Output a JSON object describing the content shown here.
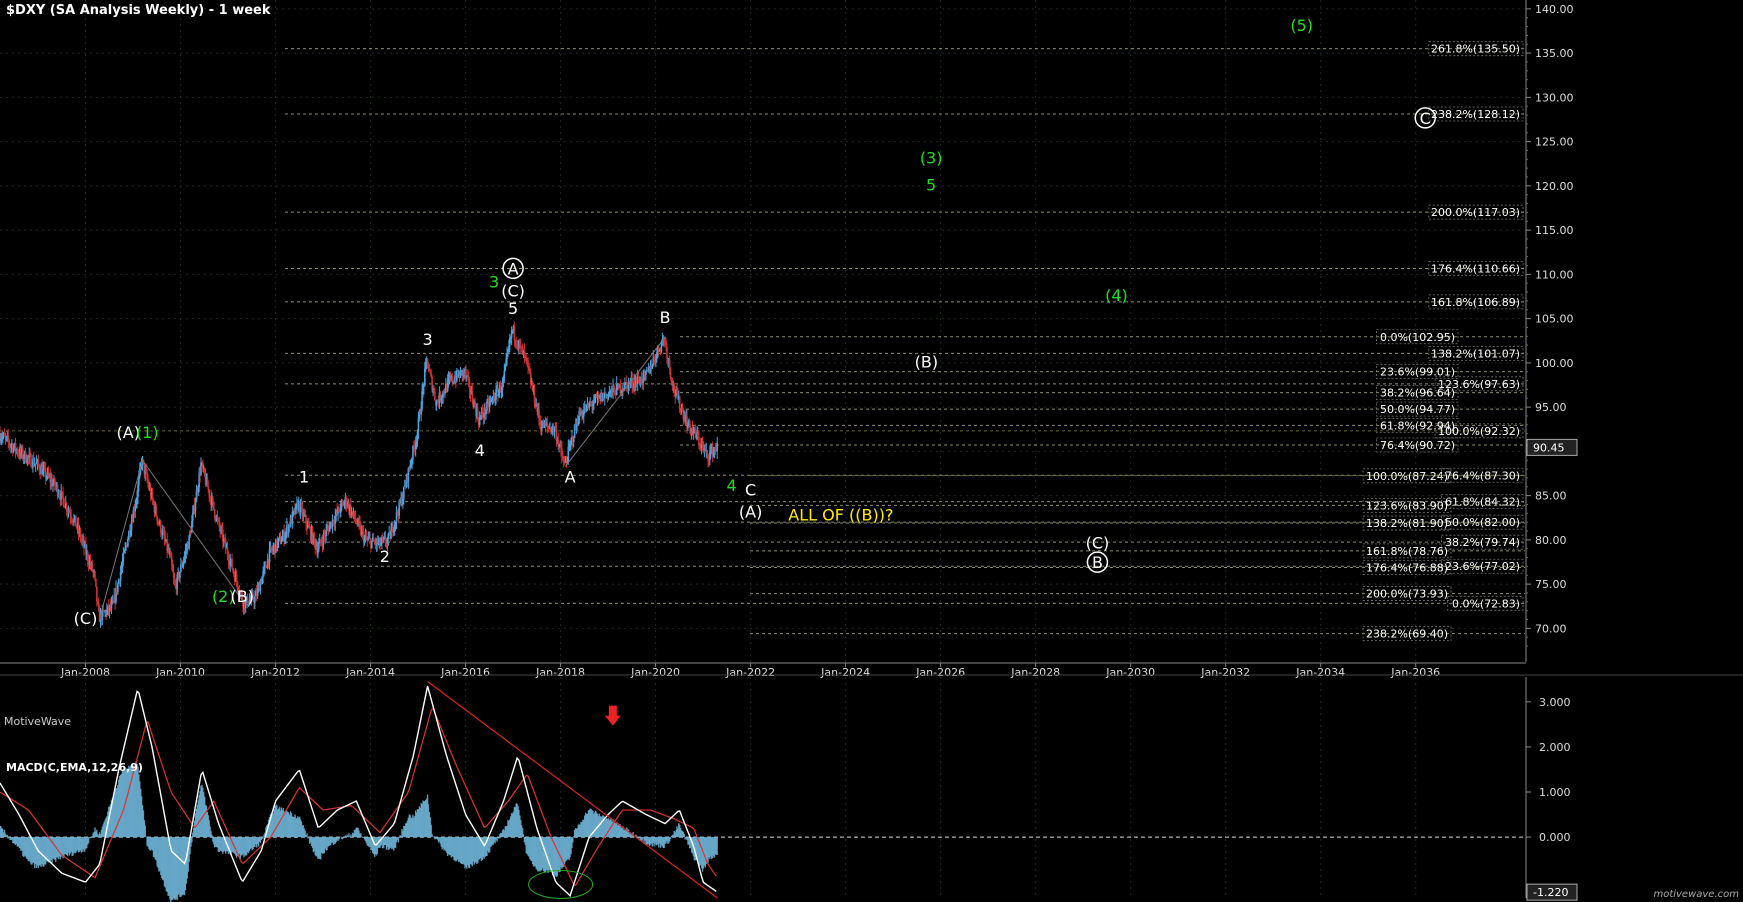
{
  "title": "$DXY (SA Analysis Weekly) - 1 week",
  "brand": "MotiveWave",
  "footer": "motivewave.com",
  "colors": {
    "background": "#000000",
    "white_label": "#ffffff",
    "green_label": "#22dd22",
    "yellow_label": "#ffee00",
    "fib_line": "#c8c8a0",
    "candle_up": "#4aa3df",
    "candle_down": "#cc3333",
    "macd_line": "#ffffff",
    "signal_line": "#dd3333",
    "histogram": "#6fb4d8",
    "trendline": "#dd2222"
  },
  "chart_data": [
    {
      "type": "candlestick",
      "title": "$DXY (SA Analysis Weekly) - 1 week",
      "x_range": [
        2006.2,
        2038.3
      ],
      "y_range": [
        66.2,
        141.0
      ],
      "y_scale": "linear",
      "grid": true,
      "x_ticks": [
        "Jan-2008",
        "Jan-2010",
        "Jan-2012",
        "Jan-2014",
        "Jan-2016",
        "Jan-2018",
        "Jan-2020",
        "Jan-2022",
        "Jan-2024",
        "Jan-2026",
        "Jan-2028",
        "Jan-2030",
        "Jan-2032",
        "Jan-2034",
        "Jan-2036"
      ],
      "y_ticks": [
        "70.00",
        "75.00",
        "80.00",
        "85.00",
        "90.00",
        "95.00",
        "100.00",
        "105.00",
        "110.00",
        "115.00",
        "120.00",
        "125.00",
        "130.00",
        "135.00",
        "140.00"
      ],
      "last_price_label": "90.45",
      "last_price": 90.45,
      "price_path": [
        [
          2006.2,
          92.0
        ],
        [
          2006.6,
          90.0
        ],
        [
          2007.0,
          88.5
        ],
        [
          2007.4,
          86.0
        ],
        [
          2007.8,
          82.0
        ],
        [
          2008.2,
          76.0
        ],
        [
          2008.3,
          71.2
        ],
        [
          2008.6,
          72.5
        ],
        [
          2008.9,
          80.0
        ],
        [
          2009.1,
          85.0
        ],
        [
          2009.2,
          89.0
        ],
        [
          2009.5,
          83.0
        ],
        [
          2009.8,
          78.0
        ],
        [
          2009.9,
          74.5
        ],
        [
          2010.2,
          80.0
        ],
        [
          2010.45,
          88.5
        ],
        [
          2010.8,
          82.0
        ],
        [
          2011.1,
          77.0
        ],
        [
          2011.35,
          72.8
        ],
        [
          2011.6,
          73.5
        ],
        [
          2011.9,
          78.5
        ],
        [
          2012.2,
          80.5
        ],
        [
          2012.5,
          84.0
        ],
        [
          2012.9,
          79.0
        ],
        [
          2013.2,
          82.0
        ],
        [
          2013.5,
          84.5
        ],
        [
          2013.9,
          80.0
        ],
        [
          2014.2,
          79.5
        ],
        [
          2014.4,
          80.0
        ],
        [
          2014.7,
          85.0
        ],
        [
          2015.0,
          92.0
        ],
        [
          2015.2,
          100.3
        ],
        [
          2015.4,
          95.5
        ],
        [
          2015.7,
          98.0
        ],
        [
          2016.0,
          99.0
        ],
        [
          2016.3,
          93.5
        ],
        [
          2016.6,
          96.0
        ],
        [
          2016.8,
          97.5
        ],
        [
          2017.0,
          103.8
        ],
        [
          2017.3,
          100.0
        ],
        [
          2017.6,
          93.0
        ],
        [
          2017.9,
          92.5
        ],
        [
          2018.1,
          88.3
        ],
        [
          2018.4,
          94.0
        ],
        [
          2018.7,
          95.5
        ],
        [
          2019.0,
          96.5
        ],
        [
          2019.4,
          97.5
        ],
        [
          2019.8,
          98.3
        ],
        [
          2020.2,
          102.9
        ],
        [
          2020.4,
          97.0
        ],
        [
          2020.7,
          93.0
        ],
        [
          2020.9,
          91.5
        ],
        [
          2021.1,
          89.5
        ],
        [
          2021.3,
          90.45
        ]
      ],
      "fibonacci_levels": [
        {
          "label": "261.8%(135.50)",
          "value": 135.5
        },
        {
          "label": "238.2%(128.12)",
          "value": 128.12
        },
        {
          "label": "200.0%(117.03)",
          "value": 117.03
        },
        {
          "label": "176.4%(110.66)",
          "value": 110.66
        },
        {
          "label": "161.8%(106.89)",
          "value": 106.89
        },
        {
          "label": "0.0%(102.95)",
          "value": 102.95
        },
        {
          "label": "138.2%(101.07)",
          "value": 101.07
        },
        {
          "label": "23.6%(99.01)",
          "value": 99.01
        },
        {
          "label": "123.6%(97.63)",
          "value": 97.63
        },
        {
          "label": "38.2%(96.64)",
          "value": 96.64
        },
        {
          "label": "50.0%(94.77)",
          "value": 94.77
        },
        {
          "label": "61.8%(92.94)",
          "value": 92.94
        },
        {
          "label": "100.0%(92.32)",
          "value": 92.32
        },
        {
          "label": "76.4%(90.72)",
          "value": 90.72
        },
        {
          "label": "100.0%(87.24)",
          "value": 87.24
        },
        {
          "label": "76.4%(87.30)",
          "value": 87.3
        },
        {
          "label": "61.8%(84.32)",
          "value": 84.32
        },
        {
          "label": "123.6%(83.90)",
          "value": 83.9
        },
        {
          "label": "50.0%(82.00)",
          "value": 82.0
        },
        {
          "label": "138.2%(81.90)",
          "value": 81.9
        },
        {
          "label": "38.2%(79.74)",
          "value": 79.74
        },
        {
          "label": "161.8%(78.76)",
          "value": 78.76
        },
        {
          "label": "23.6%(77.02)",
          "value": 77.02
        },
        {
          "label": "176.4%(76.88)",
          "value": 76.88
        },
        {
          "label": "200.0%(73.93)",
          "value": 73.93
        },
        {
          "label": "0.0%(72.83)",
          "value": 72.83
        },
        {
          "label": "238.2%(69.40)",
          "value": 69.4
        }
      ],
      "wave_labels": [
        {
          "text": "(C)",
          "x": 2008.0,
          "y": 70.5,
          "color": "white"
        },
        {
          "text": "(A)",
          "x": 2008.9,
          "y": 91.5,
          "color": "white"
        },
        {
          "text": "(1)",
          "x": 2009.3,
          "y": 91.5,
          "color": "green"
        },
        {
          "text": "(2)",
          "x": 2010.9,
          "y": 73.0,
          "color": "green"
        },
        {
          "text": "(B)",
          "x": 2011.3,
          "y": 73.0,
          "color": "white"
        },
        {
          "text": "1",
          "x": 2012.6,
          "y": 86.5,
          "color": "white"
        },
        {
          "text": "2",
          "x": 2014.3,
          "y": 77.5,
          "color": "white"
        },
        {
          "text": "3",
          "x": 2015.2,
          "y": 102.0,
          "color": "white"
        },
        {
          "text": "4",
          "x": 2016.3,
          "y": 89.5,
          "color": "white"
        },
        {
          "text": "3",
          "x": 2016.6,
          "y": 108.5,
          "color": "green"
        },
        {
          "text": "5",
          "x": 2017.0,
          "y": 105.5,
          "color": "white"
        },
        {
          "text": "(C)",
          "x": 2017.0,
          "y": 107.5,
          "color": "white"
        },
        {
          "text": "A",
          "x": 2017.0,
          "y": 110.0,
          "color": "white",
          "circled": true
        },
        {
          "text": "A",
          "x": 2018.2,
          "y": 86.5,
          "color": "white"
        },
        {
          "text": "B",
          "x": 2020.2,
          "y": 104.5,
          "color": "white"
        },
        {
          "text": "4",
          "x": 2021.6,
          "y": 85.5,
          "color": "green"
        },
        {
          "text": "C",
          "x": 2022.0,
          "y": 85.0,
          "color": "white"
        },
        {
          "text": "(A)",
          "x": 2022.0,
          "y": 82.5,
          "color": "white"
        },
        {
          "text": "ALL OF ((B))?",
          "x": 2023.9,
          "y": 82.2,
          "color": "yellow"
        },
        {
          "text": "(3)",
          "x": 2025.8,
          "y": 122.5,
          "color": "green"
        },
        {
          "text": "5",
          "x": 2025.8,
          "y": 119.5,
          "color": "green"
        },
        {
          "text": "(B)",
          "x": 2025.7,
          "y": 99.5,
          "color": "white"
        },
        {
          "text": "(4)",
          "x": 2029.7,
          "y": 107.0,
          "color": "green"
        },
        {
          "text": "(5)",
          "x": 2033.6,
          "y": 137.5,
          "color": "green"
        },
        {
          "text": "(C)",
          "x": 2029.3,
          "y": 79.0,
          "color": "white"
        },
        {
          "text": "B",
          "x": 2029.3,
          "y": 76.8,
          "color": "white",
          "circled": true
        },
        {
          "text": "C",
          "x": 2036.2,
          "y": 127.0,
          "color": "white",
          "circled": true
        }
      ]
    },
    {
      "type": "line",
      "title": "MACD(C,EMA,12,26,9)",
      "y_range": [
        -1.35,
        3.55
      ],
      "y_ticks": [
        "3.000",
        "2.000",
        "1.000",
        "0.000"
      ],
      "last_value_label": "-1.220",
      "last_value": -1.22,
      "macd_path": [
        [
          2006.2,
          1.2
        ],
        [
          2006.6,
          0.5
        ],
        [
          2007.0,
          -0.3
        ],
        [
          2007.5,
          -0.8
        ],
        [
          2008.0,
          -1.0
        ],
        [
          2008.3,
          -0.6
        ],
        [
          2008.7,
          1.5
        ],
        [
          2009.1,
          3.3
        ],
        [
          2009.4,
          2.0
        ],
        [
          2009.8,
          -0.3
        ],
        [
          2010.1,
          -0.6
        ],
        [
          2010.45,
          1.5
        ],
        [
          2010.8,
          0.3
        ],
        [
          2011.3,
          -1.0
        ],
        [
          2011.7,
          -0.3
        ],
        [
          2012.0,
          0.8
        ],
        [
          2012.5,
          1.5
        ],
        [
          2012.9,
          0.2
        ],
        [
          2013.3,
          0.6
        ],
        [
          2013.7,
          0.8
        ],
        [
          2014.1,
          -0.2
        ],
        [
          2014.5,
          0.3
        ],
        [
          2014.9,
          1.8
        ],
        [
          2015.2,
          3.35
        ],
        [
          2015.6,
          1.8
        ],
        [
          2016.0,
          0.5
        ],
        [
          2016.4,
          -0.2
        ],
        [
          2016.8,
          0.8
        ],
        [
          2017.1,
          1.8
        ],
        [
          2017.5,
          0.2
        ],
        [
          2017.9,
          -1.0
        ],
        [
          2018.2,
          -1.3
        ],
        [
          2018.6,
          0.0
        ],
        [
          2019.0,
          0.5
        ],
        [
          2019.3,
          0.8
        ],
        [
          2019.8,
          0.5
        ],
        [
          2020.2,
          0.3
        ],
        [
          2020.5,
          0.6
        ],
        [
          2020.8,
          -0.2
        ],
        [
          2021.0,
          -1.0
        ],
        [
          2021.3,
          -1.22
        ]
      ],
      "signal_path": [
        [
          2006.2,
          1.0
        ],
        [
          2006.8,
          0.6
        ],
        [
          2007.5,
          -0.4
        ],
        [
          2008.2,
          -0.9
        ],
        [
          2008.8,
          0.6
        ],
        [
          2009.3,
          2.6
        ],
        [
          2009.8,
          1.0
        ],
        [
          2010.3,
          0.2
        ],
        [
          2010.7,
          0.8
        ],
        [
          2011.3,
          -0.6
        ],
        [
          2011.9,
          0.0
        ],
        [
          2012.5,
          1.1
        ],
        [
          2013.0,
          0.6
        ],
        [
          2013.6,
          0.7
        ],
        [
          2014.2,
          0.1
        ],
        [
          2014.8,
          1.0
        ],
        [
          2015.3,
          2.9
        ],
        [
          2015.8,
          1.6
        ],
        [
          2016.4,
          0.2
        ],
        [
          2016.9,
          0.8
        ],
        [
          2017.3,
          1.4
        ],
        [
          2017.8,
          0.0
        ],
        [
          2018.3,
          -1.1
        ],
        [
          2018.8,
          -0.2
        ],
        [
          2019.3,
          0.6
        ],
        [
          2019.9,
          0.6
        ],
        [
          2020.4,
          0.4
        ],
        [
          2020.8,
          0.2
        ],
        [
          2021.1,
          -0.6
        ],
        [
          2021.3,
          -0.9
        ]
      ],
      "annotation": "red down-arrow above 2019 peak",
      "trendline": [
        [
          2015.2,
          3.45
        ],
        [
          2021.3,
          -1.35
        ]
      ]
    }
  ]
}
